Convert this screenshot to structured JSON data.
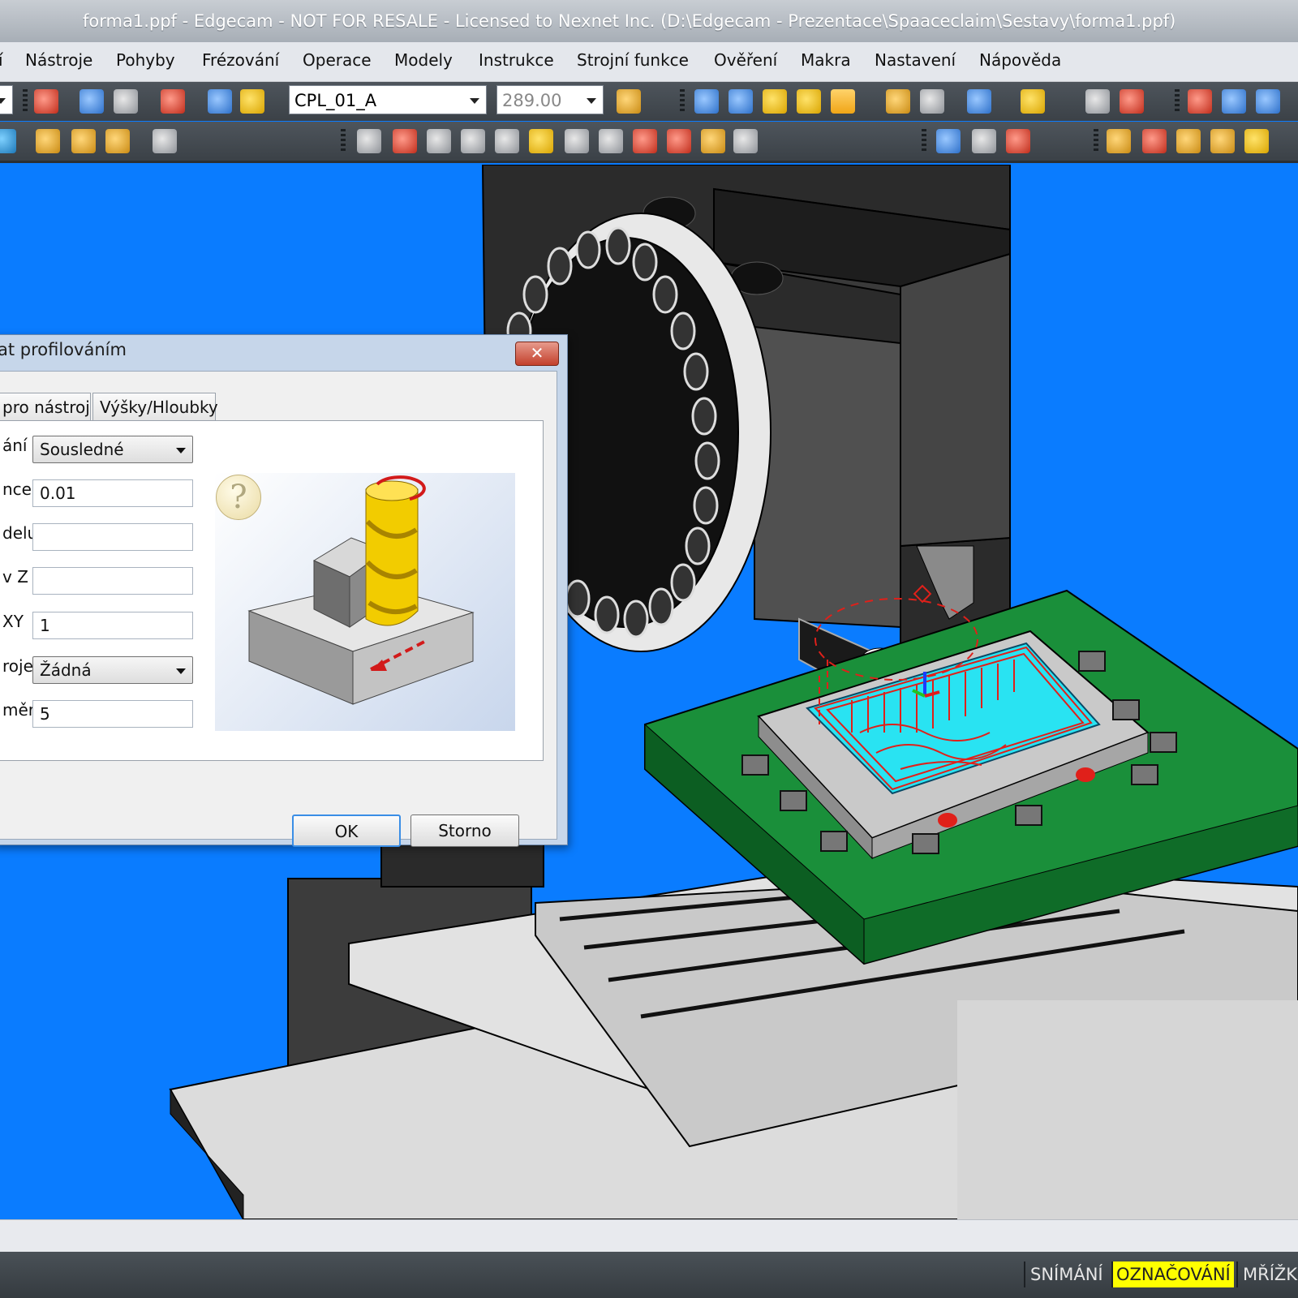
{
  "window": {
    "title": "forma1.ppf - Edgecam - NOT FOR RESALE - Licensed to Nexnet Inc. (D:\\Edgecam - Prezentace\\Spaaceclaim\\Sestavy\\forma1.ppf)"
  },
  "menu": {
    "items": [
      {
        "label": "í"
      },
      {
        "label": "Nástroje"
      },
      {
        "label": "Pohyby"
      },
      {
        "label": "Frézování"
      },
      {
        "label": "Operace"
      },
      {
        "label": "Modely"
      },
      {
        "label": "Instrukce"
      },
      {
        "label": "Strojní funkce"
      },
      {
        "label": "Ověření"
      },
      {
        "label": "Makra"
      },
      {
        "label": "Nastavení"
      },
      {
        "label": "Nápověda"
      }
    ]
  },
  "toolbar": {
    "cpl_select": "CPL_01_A",
    "value_select": "289.00"
  },
  "dialog": {
    "title": "at profilováním",
    "close_label": "✕",
    "tabs": [
      {
        "label": " pro nástroj"
      },
      {
        "label": "Výšky/Hloubky"
      }
    ],
    "fields": [
      {
        "label": "ání",
        "value": "Sousledné",
        "type": "select"
      },
      {
        "label": "nce",
        "value": "0.01",
        "type": "text"
      },
      {
        "label": "delu",
        "value": "",
        "type": "text"
      },
      {
        "label": "v Z",
        "value": "",
        "type": "text"
      },
      {
        "label": " XY",
        "value": "1",
        "type": "text"
      },
      {
        "label": "roje",
        "value": "Žádná",
        "type": "select"
      },
      {
        "label": "měr",
        "value": "5",
        "type": "text"
      }
    ],
    "help_label": "?",
    "ok_label": "OK",
    "cancel_label": "Storno"
  },
  "status": {
    "segments": [
      {
        "label": "SNÍMÁNÍ",
        "highlight": false
      },
      {
        "label": "OZNAČOVÁNÍ",
        "highlight": true
      },
      {
        "label": "MŘÍŽK",
        "highlight": false
      }
    ]
  },
  "colors": {
    "viewport_bg": "#0a7cff",
    "status_highlight": "#ffff00",
    "fixture_plate": "#1a8f3a",
    "mold_cavity": "#29e3f2",
    "toolpath": "#e0201a"
  }
}
